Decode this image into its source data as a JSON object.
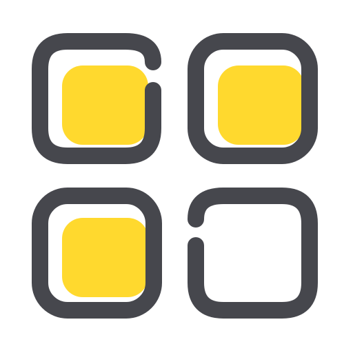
{
  "icon": {
    "name": "app-grid-icon",
    "colors": {
      "background": "#ffffff",
      "outline": "#46474d",
      "fill": "#ffd92e"
    },
    "tiles": [
      {
        "name": "tile-top-left",
        "filled": true,
        "outline": "gap-top-right"
      },
      {
        "name": "tile-top-right",
        "filled": true,
        "outline": "closed"
      },
      {
        "name": "tile-bottom-left",
        "filled": true,
        "outline": "closed"
      },
      {
        "name": "tile-bottom-right",
        "filled": false,
        "outline": "gap-left"
      }
    ]
  }
}
